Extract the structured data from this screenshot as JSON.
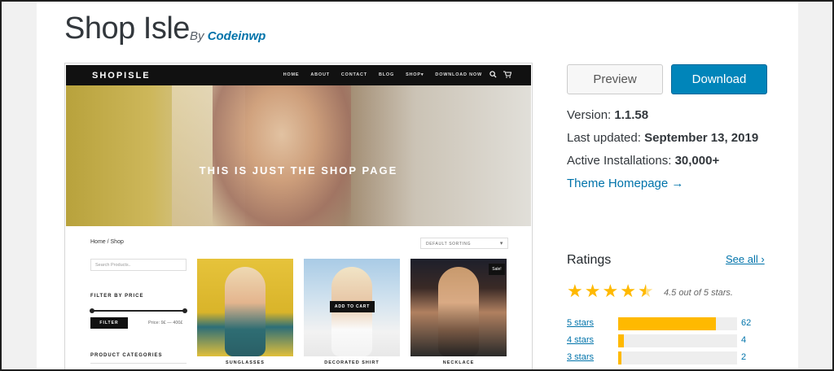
{
  "theme": {
    "title": "Shop Isle",
    "by_label": "By",
    "author": "Codeinwp"
  },
  "screenshot": {
    "logo": "SHOPISLE",
    "menu": [
      "HOME",
      "ABOUT",
      "CONTACT",
      "BLOG",
      "SHOP▾",
      "DOWNLOAD NOW"
    ],
    "hero_text": "THIS IS JUST THE SHOP PAGE",
    "breadcrumb": "Home / Shop",
    "sort_label": "DEFAULT SORTING",
    "search_placeholder": "Search Products..",
    "filter_title": "FILTER BY PRICE",
    "filter_button": "FILTER",
    "price_range": "Price: 9£ — 400£",
    "categories_title": "PRODUCT CATEGORIES",
    "add_to_cart": "ADD TO CART",
    "sale_badge": "Sale!",
    "products": [
      "SUNGLASSES",
      "DECORATED SHIRT",
      "NECKLACE"
    ]
  },
  "actions": {
    "preview": "Preview",
    "download": "Download"
  },
  "meta": {
    "version_label": "Version:",
    "version": "1.1.58",
    "updated_label": "Last updated:",
    "updated": "September 13, 2019",
    "installs_label": "Active Installations:",
    "installs": "30,000+",
    "homepage_link": "Theme Homepage →"
  },
  "ratings": {
    "title": "Ratings",
    "see_all": "See all ›",
    "summary": "4.5 out of 5 stars.",
    "star_value": 4.5,
    "star_color": "#ffb900",
    "rows": [
      {
        "label": "5 stars",
        "count": "62",
        "fraction": 0.82
      },
      {
        "label": "4 stars",
        "count": "4",
        "fraction": 0.05
      },
      {
        "label": "3 stars",
        "count": "2",
        "fraction": 0.03
      }
    ]
  }
}
